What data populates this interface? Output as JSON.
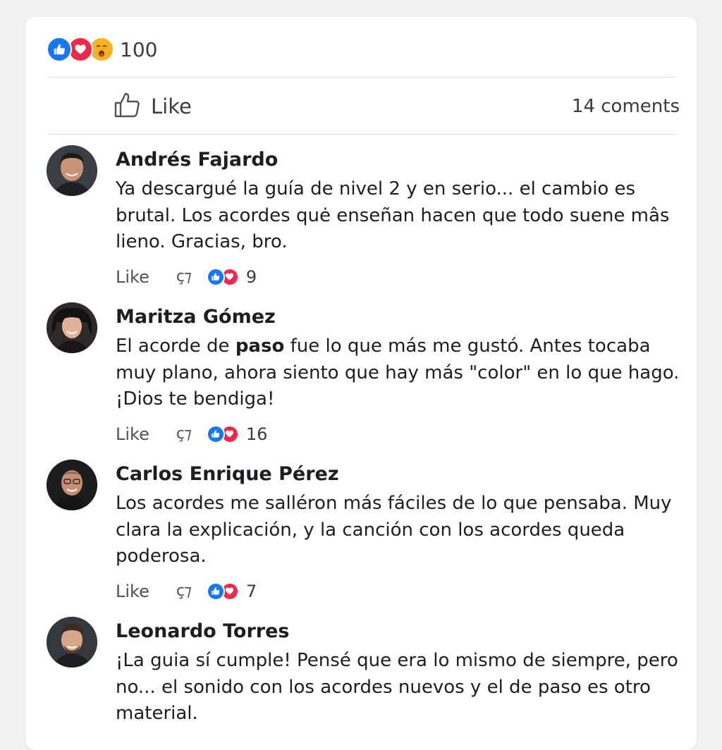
{
  "post": {
    "reactions_total": "100",
    "like_label": "Like",
    "comments_count": "14 coments",
    "reaction_icons": [
      "like-icon",
      "love-icon",
      "sad-icon"
    ]
  },
  "colors": {
    "like": "#1877f2",
    "love": "#f0284a",
    "sad": "#f7b125"
  },
  "comments": [
    {
      "name": "Andrés Fajardo",
      "text": "Ya descargué la guía de nivel 2 y en serio... el cambio es brutal. Los acordes quė enseñan hacen que todo suene mâs lieno. Gracias, bro.",
      "like_label": "Like",
      "reply_glyph": "ҫ⁊",
      "reaction_count": "9"
    },
    {
      "name": "Maritza Gómez",
      "text_before": "El acorde de ",
      "text_bold": "paso",
      "text_after": " fue lo que más me gustó. Antes tocaba muy plano, ahora siento que hay más \"color\" en lo que hago. ¡Dios te bendiga!",
      "like_label": "Like",
      "reply_glyph": "ҫ⁊",
      "reaction_count": "16"
    },
    {
      "name": "Carlos Enrique Pérez",
      "text": "Los acordes me salléron más fáciles de lo que pensaba. Muy clara la explicación, y la canción con los acordes queda poderosa.",
      "like_label": "Like",
      "reply_glyph": "ҫ⁊",
      "reaction_count": "7"
    },
    {
      "name": "Leonardo Torres",
      "text": "¡La guia sí cumple! Pensé que era lo mismo de siempre, pero no... el sonido con los acordes nuevos y el de paso es otro material."
    }
  ]
}
